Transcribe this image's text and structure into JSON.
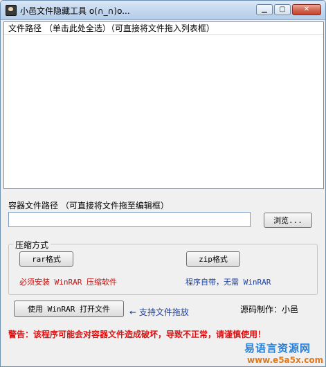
{
  "window": {
    "title": "小邑文件隐藏工具 o(∩_∩)o...",
    "minimize_glyph": "▁",
    "maximize_glyph": "▢",
    "close_glyph": "✕"
  },
  "file_list": {
    "header": "文件路径 （单击此处全选）（可直接将文件拖入列表框）"
  },
  "container": {
    "label": "容器文件路径   （可直接将文件拖至编辑框）",
    "path_value": "",
    "browse_label": "浏览..."
  },
  "compression": {
    "group_title": "压缩方式",
    "rar_label": "rar格式",
    "zip_label": "zip格式",
    "rar_note": "必须安装 WinRAR 压缩软件",
    "zip_note": "程序自带，无需 WinRAR"
  },
  "open_with_winrar_label": "使用 WinRAR 打开文件",
  "drag_support_note": "← 支持文件拖放",
  "author_credit": "源码制作：小邑",
  "warning": "警告：该程序可能会对容器文件造成破坏，导致不正常，请谨慎使用！",
  "watermark": {
    "text": "易语言资源网",
    "url": "www.e5a5x.com"
  }
}
